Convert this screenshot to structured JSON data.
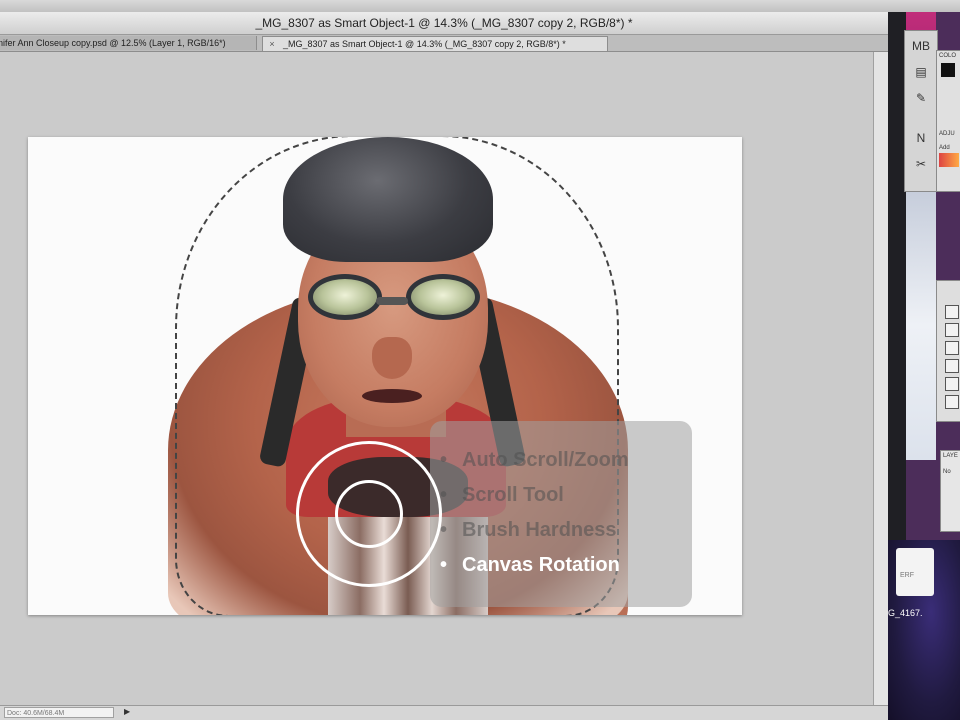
{
  "window": {
    "title": "_MG_8307 as Smart Object-1 @ 14.3% (_MG_8307 copy 2, RGB/8*) *"
  },
  "tabs": [
    {
      "label": "nifer Ann Closeup copy.psd @ 12.5% (Layer 1, RGB/16*)",
      "active": false
    },
    {
      "label": "_MG_8307 as Smart Object-1 @ 14.3% (_MG_8307 copy 2, RGB/8*) *",
      "active": true
    }
  ],
  "tab_close_glyph": "×",
  "status_bar": {
    "doc_info": "Doc: 40.6M/68.4M",
    "arrow": "▶"
  },
  "overlay_menu": {
    "items": [
      {
        "label": "Auto Scroll/Zoom",
        "active": false
      },
      {
        "label": "Scroll Tool",
        "active": false
      },
      {
        "label": "Brush Hardness",
        "active": false
      },
      {
        "label": "Canvas Rotation",
        "active": true
      }
    ],
    "bullet": "•"
  },
  "right_panel": {
    "color_label": "COLO",
    "adjust_label": "ADJU",
    "add_label": "Add",
    "layers_label": "LAYE",
    "layers_mode": "No",
    "desktop_file_ext": "ERF",
    "desktop_file_name": "G_4167.",
    "tools": [
      "MB",
      "▤",
      "✎",
      "N",
      "✂"
    ]
  },
  "icons": {
    "tab_close": "close-icon",
    "brush": "brush-cursor-icon"
  }
}
